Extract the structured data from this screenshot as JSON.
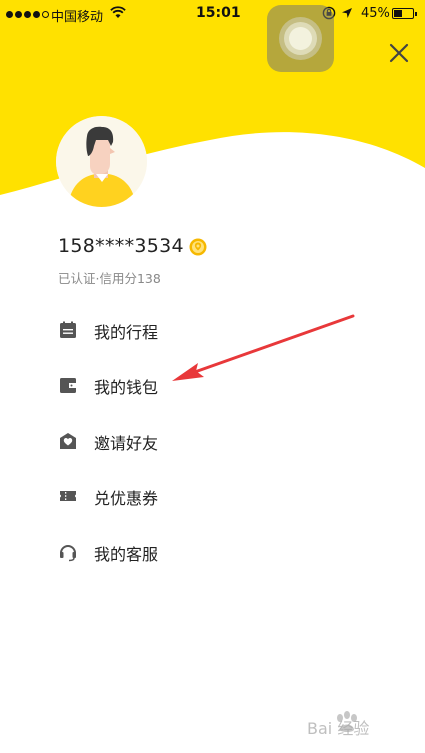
{
  "status_bar": {
    "carrier": "中国移动",
    "time": "15:01",
    "battery_percent": "45%",
    "battery_level": 0.45
  },
  "header": {
    "close_icon": "close-icon"
  },
  "profile": {
    "phone": "158****3534",
    "verification": "已认证·信用分138"
  },
  "menu": [
    {
      "label": "我的行程",
      "icon": "calendar-icon"
    },
    {
      "label": "我的钱包",
      "icon": "wallet-icon"
    },
    {
      "label": "邀请好友",
      "icon": "heart-envelope-icon"
    },
    {
      "label": "兑优惠券",
      "icon": "ticket-icon"
    },
    {
      "label": "我的客服",
      "icon": "headset-icon"
    }
  ],
  "colors": {
    "brand_yellow": "#FFE100",
    "icon_gray": "#555555",
    "arrow_red": "#E8383A"
  },
  "watermark": {
    "text": "Bai 经验"
  }
}
